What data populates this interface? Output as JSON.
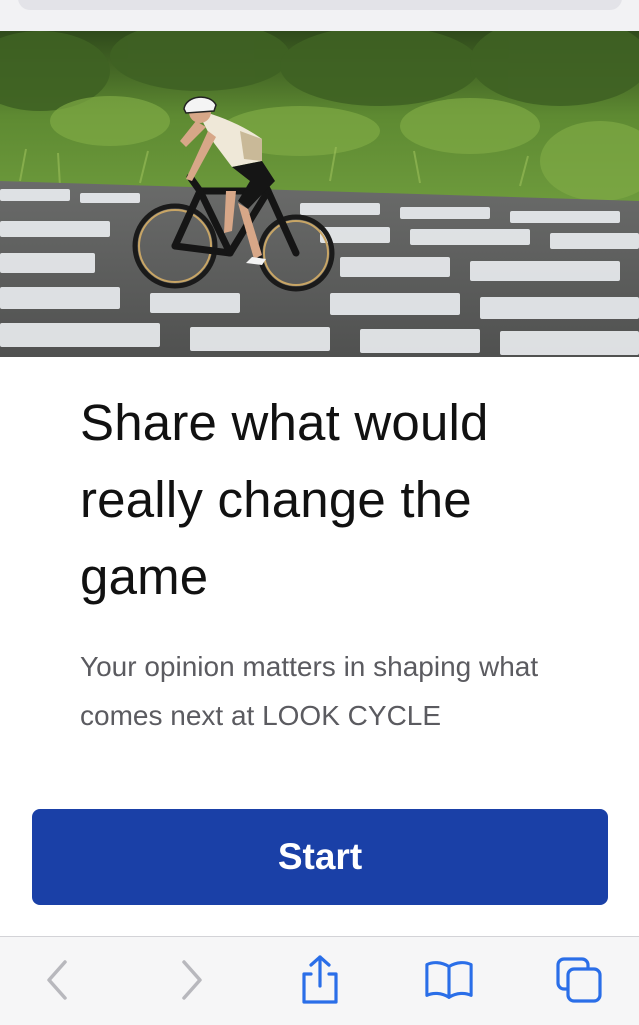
{
  "hero": {
    "image_name": "cyclist-riding-on-painted-road"
  },
  "content": {
    "headline": "Share what would really change the game",
    "subtext": "Your opinion matters in shaping what comes next at LOOK CYCLE"
  },
  "cta": {
    "start_label": "Start",
    "color": "#1a40a7"
  },
  "toolbar": {
    "icons": [
      "chevron-left-icon",
      "chevron-right-icon",
      "share-icon",
      "bookmarks-icon",
      "tabs-icon"
    ],
    "accent_color": "#2a6ee8",
    "disabled_color": "#b8b8bd"
  }
}
